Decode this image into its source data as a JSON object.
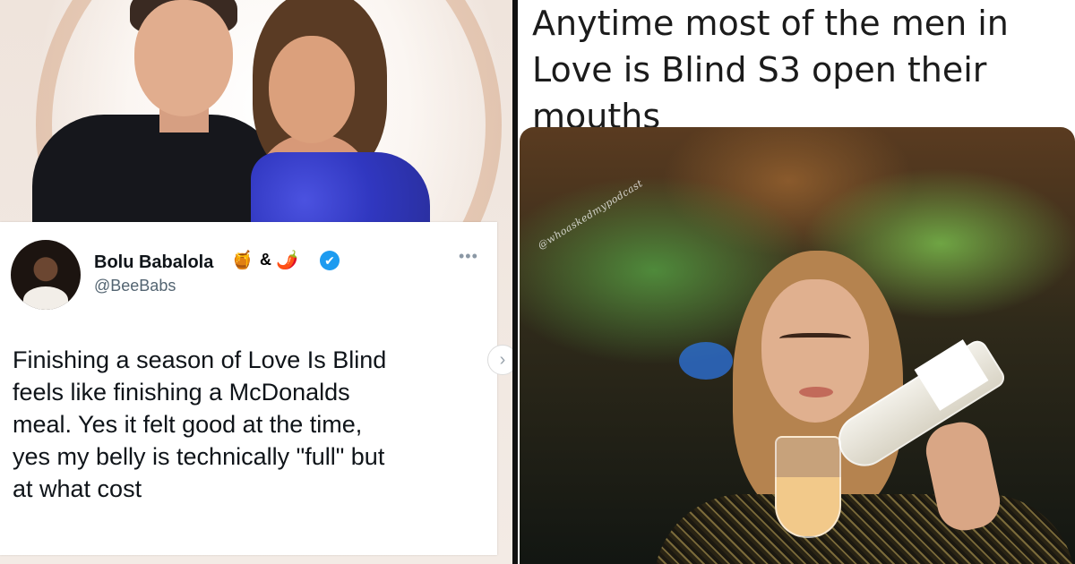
{
  "left_panel": {
    "tweet": {
      "author_name": "Bolu Babalola",
      "name_emojis": [
        "🍯",
        "&",
        "🌶️"
      ],
      "verified_mark": "✔",
      "handle": "@BeeBabs",
      "more_glyph": "•••",
      "text": "Finishing a season of Love Is Blind\nfeels like finishing a McDonalds\nmeal. Yes it felt good at the time,\nyes my belly is technically \"full\" but\nat what cost"
    },
    "carousel_next_glyph": "›",
    "colors": {
      "verified": "#1d9bf0",
      "dress": "#3037c0"
    }
  },
  "right_panel": {
    "caption": "Anytime most of the men in\nLove is Blind S3 open their\nmouths",
    "watermark": "@whoaskedmypodcast"
  }
}
